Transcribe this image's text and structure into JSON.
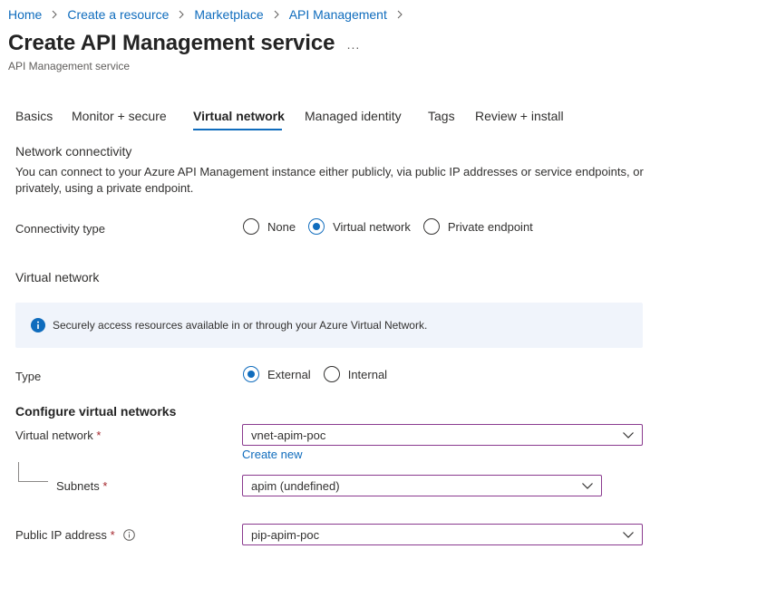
{
  "breadcrumb": {
    "items": [
      "Home",
      "Create a resource",
      "Marketplace",
      "API Management"
    ]
  },
  "header": {
    "title": "Create API Management service",
    "more_label": "...",
    "subtitle": "API Management service"
  },
  "tabs": [
    {
      "label": "Basics",
      "active": false
    },
    {
      "label": "Monitor + secure",
      "active": false
    },
    {
      "label": "Virtual network",
      "active": true
    },
    {
      "label": "Managed identity",
      "active": false
    },
    {
      "label": "Tags",
      "active": false
    },
    {
      "label": "Review + install",
      "active": false
    }
  ],
  "network_connectivity": {
    "heading": "Network connectivity",
    "description": "You can connect to your Azure API Management instance either publicly, via public IP addresses or service endpoints, or privately, using a private endpoint.",
    "connectivity_label": "Connectivity type",
    "options": [
      {
        "label": "None",
        "checked": false
      },
      {
        "label": "Virtual network",
        "checked": true
      },
      {
        "label": "Private endpoint",
        "checked": false
      }
    ]
  },
  "virtual_network_section": {
    "heading": "Virtual network",
    "info_text": "Securely access resources available in or through your Azure Virtual Network.",
    "type_label": "Type",
    "type_options": [
      {
        "label": "External",
        "checked": true
      },
      {
        "label": "Internal",
        "checked": false
      }
    ]
  },
  "configure": {
    "heading": "Configure virtual networks",
    "vnet_label": "Virtual network",
    "vnet_value": "vnet-apim-poc",
    "create_new": "Create new",
    "subnets_label": "Subnets",
    "subnets_value": "apim (undefined)",
    "pip_label": "Public IP address",
    "pip_value": "pip-apim-poc",
    "required_marker": "*"
  },
  "colors": {
    "accent": "#0f6cbd",
    "required": "#a4262c",
    "dropdown_border": "#8a3a8f",
    "info_bg": "#f0f4fb"
  }
}
